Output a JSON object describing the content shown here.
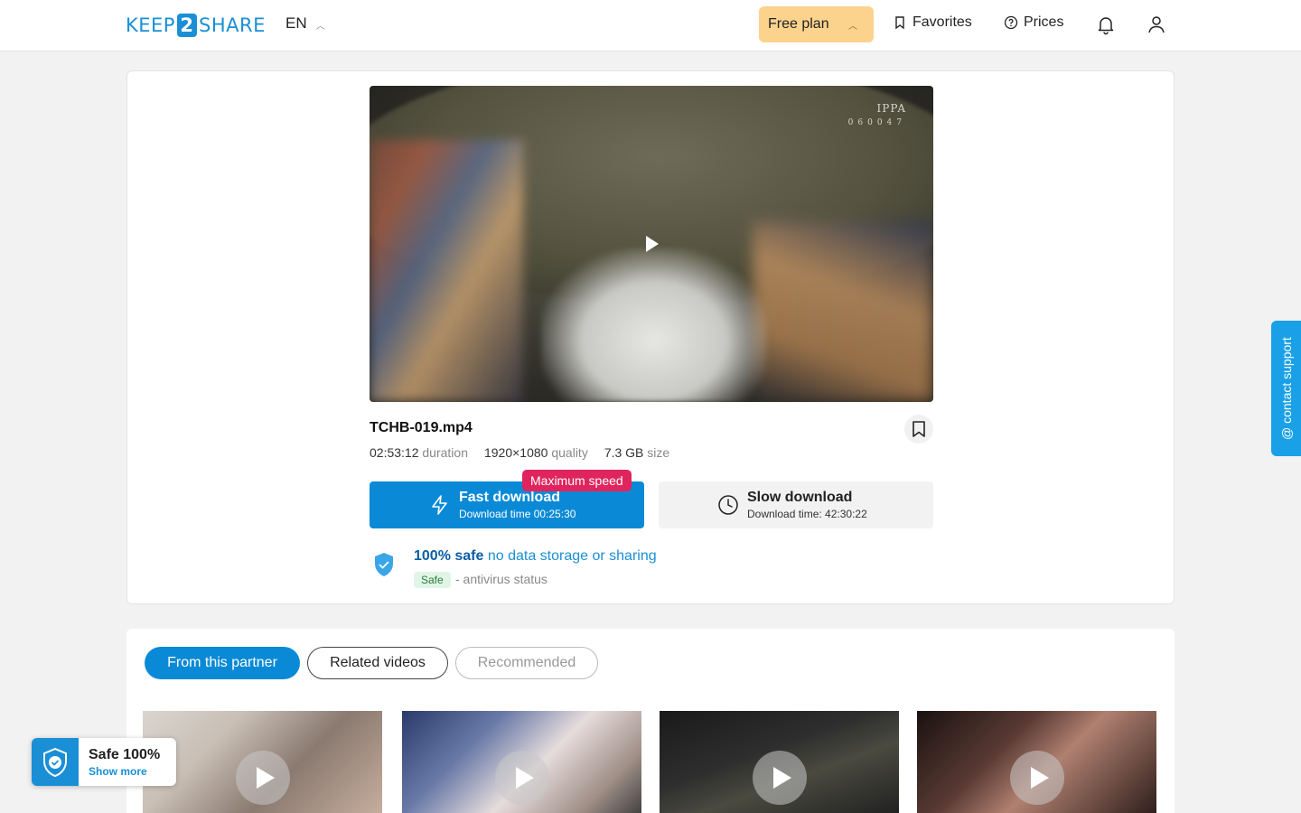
{
  "header": {
    "logo_left": "KEEP",
    "logo_mid": "2",
    "logo_right": "SHARE",
    "language": "EN",
    "plan_label": "Free plan",
    "favorites_label": "Favorites",
    "prices_label": "Prices"
  },
  "video": {
    "watermark_brand": "IPPA",
    "watermark_number": "060047"
  },
  "file": {
    "name": "TCHB-019.mp4",
    "duration_value": "02:53:12",
    "duration_label": "duration",
    "quality_value": "1920×1080",
    "quality_label": "quality",
    "size_value": "7.3 GB",
    "size_label": "size"
  },
  "download": {
    "badge": "Maximum speed",
    "fast_title": "Fast download",
    "fast_sub": "Download time 00:25:30",
    "slow_title": "Slow download",
    "slow_sub": "Download time: 42:30:22"
  },
  "safety": {
    "bold": "100% safe",
    "text": "no data storage or sharing",
    "badge": "Safe",
    "antivirus": "- antivirus status"
  },
  "tabs": {
    "partner": "From this partner",
    "related": "Related videos",
    "recommended": "Recommended"
  },
  "support": {
    "label": "@ contact support"
  },
  "safe_widget": {
    "title": "Safe 100%",
    "link": "Show more"
  },
  "colors": {
    "brand": "#1a8fd6",
    "plan_bg": "#fbd38d",
    "fast_btn": "#0a8ad6",
    "badge": "#e0245e"
  }
}
